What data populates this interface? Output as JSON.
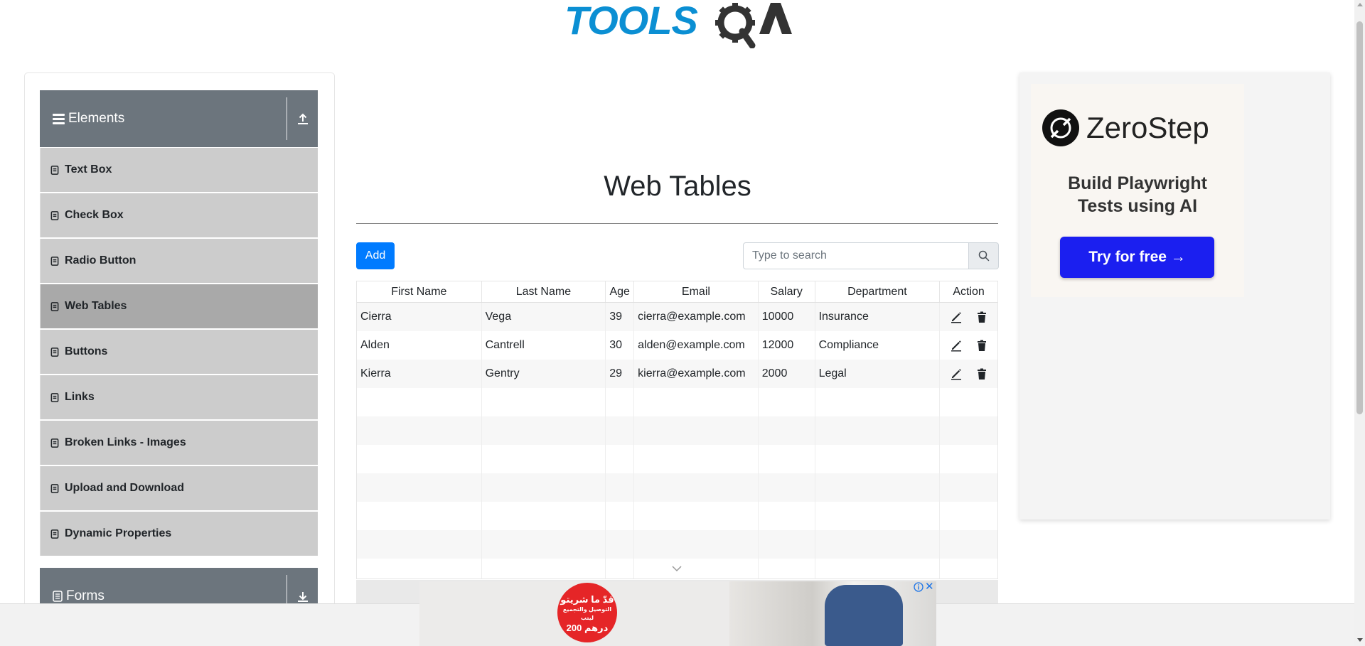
{
  "header": {
    "logo_text": "TOOLSQA"
  },
  "sidebar": {
    "group_title": "Elements",
    "items": [
      {
        "label": "Text Box",
        "active": false
      },
      {
        "label": "Check Box",
        "active": false
      },
      {
        "label": "Radio Button",
        "active": false
      },
      {
        "label": "Web Tables",
        "active": true
      },
      {
        "label": "Buttons",
        "active": false
      },
      {
        "label": "Links",
        "active": false
      },
      {
        "label": "Broken Links - Images",
        "active": false
      },
      {
        "label": "Upload and Download",
        "active": false
      },
      {
        "label": "Dynamic Properties",
        "active": false
      }
    ],
    "next_group_title": "Forms"
  },
  "main": {
    "title": "Web Tables",
    "add_label": "Add",
    "search_placeholder": "Type to search",
    "columns": [
      "First Name",
      "Last Name",
      "Age",
      "Email",
      "Salary",
      "Department",
      "Action"
    ],
    "rows": [
      {
        "first": "Cierra",
        "last": "Vega",
        "age": "39",
        "email": "cierra@example.com",
        "salary": "10000",
        "dept": "Insurance"
      },
      {
        "first": "Alden",
        "last": "Cantrell",
        "age": "30",
        "email": "alden@example.com",
        "salary": "12000",
        "dept": "Compliance"
      },
      {
        "first": "Kierra",
        "last": "Gentry",
        "age": "29",
        "email": "kierra@example.com",
        "salary": "2000",
        "dept": "Legal"
      }
    ],
    "empty_rows": 7
  },
  "right_ad": {
    "brand": "ZeroStep",
    "tagline_line1": "Build Playwright",
    "tagline_line2": "Tests using AI",
    "cta": "Try for free →"
  },
  "bottom_ad": {
    "line1": "قدّ ما شريتو",
    "line2": "التوصيل والتجميع ليتب",
    "line3": "200 درهم",
    "close": "✕"
  },
  "colors": {
    "primary": "#007bff",
    "group_header": "#6c757d",
    "menu_item": "#cccccc",
    "menu_active": "#a9a9a9",
    "ad_cta": "#1b1ff0",
    "logo_blue": "#0b8fd3"
  },
  "icons": {
    "edit": "pencil-icon",
    "delete": "trash-icon",
    "search": "search-icon",
    "collapse": "upload-icon",
    "expand": "download-icon"
  }
}
